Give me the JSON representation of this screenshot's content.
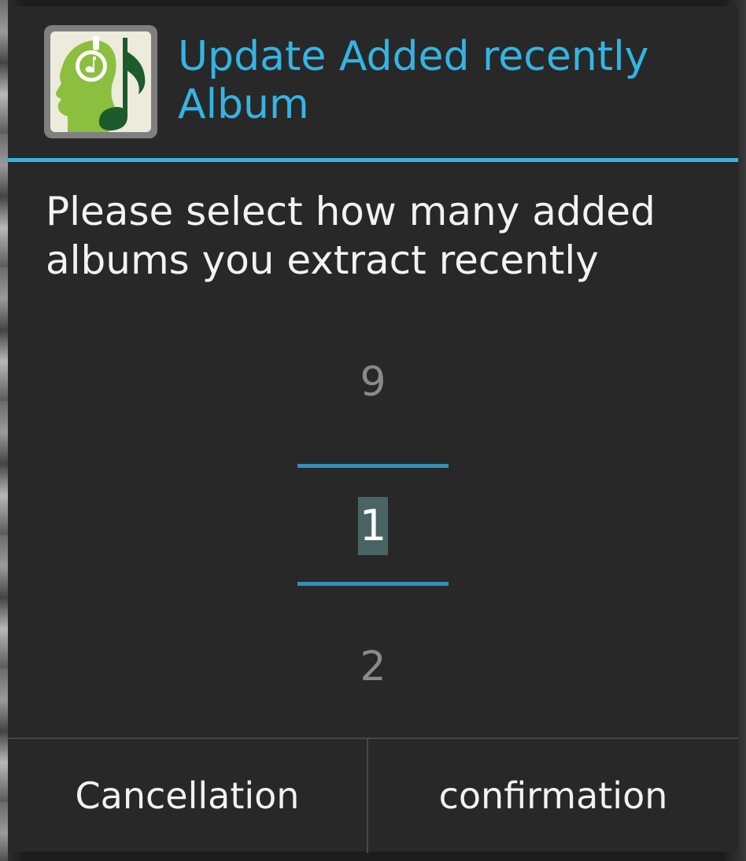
{
  "dialog": {
    "title": "Update Added recently Album",
    "message": "Please select how many added albums you extract recently",
    "app_icon": "music-headphones-app-icon"
  },
  "picker": {
    "previous_value": "9",
    "current_value": "1",
    "next_value": "2"
  },
  "buttons": {
    "cancel_label": "Cancellation",
    "confirm_label": "confirmation"
  },
  "colors": {
    "accent": "#33b5e5",
    "picker_line": "#3291b8",
    "dialog_background": "#282828",
    "selected_highlight": "#4a6464"
  }
}
